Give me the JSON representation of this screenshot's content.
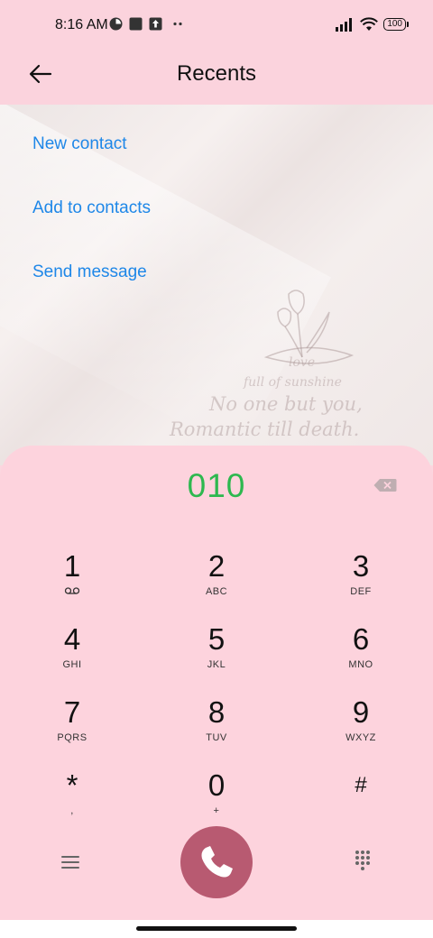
{
  "status_bar": {
    "time": "8:16 AM",
    "notif_icons": [
      "circle-app-icon",
      "square-app-icon",
      "upload-icon",
      "more-dots-icon"
    ],
    "battery": "100",
    "icons": [
      "signal-icon",
      "wifi-icon",
      "battery-icon"
    ]
  },
  "header": {
    "title": "Recents"
  },
  "actions": {
    "new_contact": "New contact",
    "add_to_contacts": "Add to contacts",
    "send_message": "Send message"
  },
  "wallpaper": {
    "line1": "love",
    "line2": "full of sunshine",
    "line3": "No one but you,",
    "line4": "Romantic till death."
  },
  "dialer": {
    "number": "010",
    "keys": [
      {
        "digit": "1",
        "letters": ""
      },
      {
        "digit": "2",
        "letters": "ABC"
      },
      {
        "digit": "3",
        "letters": "DEF"
      },
      {
        "digit": "4",
        "letters": "GHI"
      },
      {
        "digit": "5",
        "letters": "JKL"
      },
      {
        "digit": "6",
        "letters": "MNO"
      },
      {
        "digit": "7",
        "letters": "PQRS"
      },
      {
        "digit": "8",
        "letters": "TUV"
      },
      {
        "digit": "9",
        "letters": "WXYZ"
      },
      {
        "digit": "*",
        "letters": ","
      },
      {
        "digit": "0",
        "letters": "+"
      },
      {
        "digit": "#",
        "letters": ""
      }
    ]
  },
  "colors": {
    "accent_blue": "#1e87e8",
    "number_green": "#2db84f",
    "call_button": "#b85a71",
    "panel_pink": "#fdd3dd"
  }
}
